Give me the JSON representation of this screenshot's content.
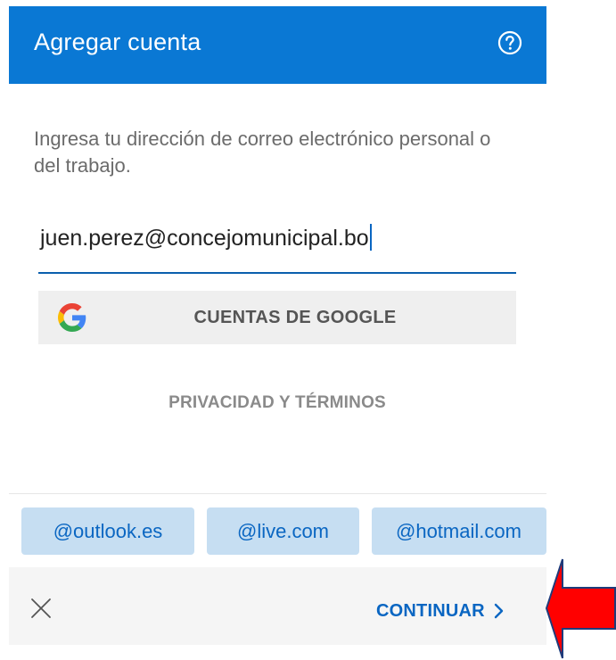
{
  "header": {
    "title": "Agregar cuenta",
    "help_icon": "help-circle-icon"
  },
  "form": {
    "instruction": "Ingresa tu dirección de correo electrónico personal o del trabajo.",
    "email_value": "juen.perez@concejomunicipal.bo",
    "google_button_label": "CUENTAS DE GOOGLE",
    "google_icon": "google-logo-icon",
    "privacy_link": "PRIVACIDAD Y TÉRMINOS"
  },
  "domain_suggestions": [
    {
      "label": "@outlook.es"
    },
    {
      "label": "@live.com"
    },
    {
      "label": "@hotmail.com"
    }
  ],
  "footer": {
    "close_icon": "close-icon",
    "continue_label": "CONTINUAR",
    "continue_icon": "chevron-right-icon"
  },
  "annotation": {
    "arrow_icon": "red-arrow-pointer",
    "color": "#ff0000"
  },
  "colors": {
    "accent": "#0a78d4",
    "link": "#0a66c2",
    "chip_bg": "#c6def2"
  }
}
